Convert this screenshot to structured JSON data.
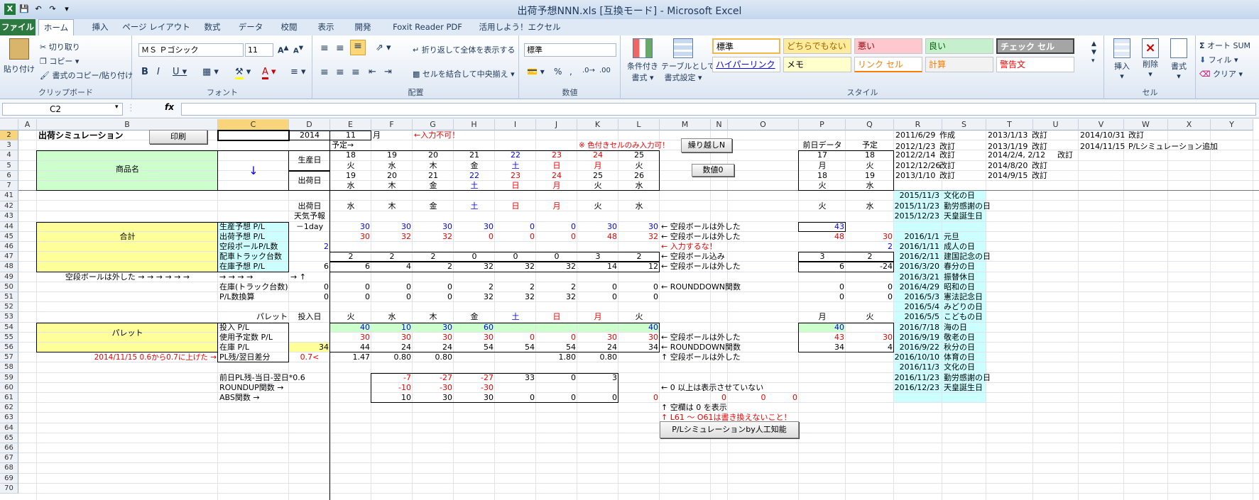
{
  "window": {
    "title": "出荷予想NNN.xls  [互換モード] - Microsoft Excel"
  },
  "ribbon": {
    "tabs": [
      "ファイル",
      "ホーム",
      "挿入",
      "ページ レイアウト",
      "数式",
      "データ",
      "校閲",
      "表示",
      "開発",
      "Foxit Reader PDF",
      "活用しよう！エクセル"
    ],
    "groups": {
      "clipboard": "クリップボード",
      "font": "フォント",
      "align": "配置",
      "number": "数値",
      "styles": "スタイル",
      "cells": "セル"
    },
    "paste": "貼り付け",
    "cut": "切り取り",
    "copy": "コピー ▾",
    "format_painter": "書式のコピー/貼り付け",
    "font_name": "ＭＳ Ｐゴシック",
    "font_size": "11",
    "wrap": "折り返して全体を表示する",
    "merge": "セルを結合して中央揃え ▾",
    "number_format": "標準",
    "cond_format": "条件付き",
    "cond_format2": "書式 ▾",
    "table_format": "テーブルとして",
    "table_format2": "書式設定 ▾",
    "styles": [
      {
        "label": "標準",
        "bg": "#ffffff",
        "fg": "#000000"
      },
      {
        "label": "どちらでもない",
        "bg": "#ffeb9c",
        "fg": "#9c6500"
      },
      {
        "label": "悪い",
        "bg": "#ffc7ce",
        "fg": "#9c0006"
      },
      {
        "label": "良い",
        "bg": "#c6efce",
        "fg": "#006100"
      },
      {
        "label": "チェック セル",
        "bg": "#a5a5a5",
        "fg": "#ffffff"
      },
      {
        "label": "ハイパーリンク",
        "bg": "#ffffff",
        "fg": "#0000ff"
      },
      {
        "label": "メモ",
        "bg": "#ffffcc",
        "fg": "#000000"
      },
      {
        "label": "リンク セル",
        "bg": "#ffffff",
        "fg": "#fa7d00"
      },
      {
        "label": "計算",
        "bg": "#f2f2f2",
        "fg": "#fa7d00"
      },
      {
        "label": "警告文",
        "bg": "#ffffff",
        "fg": "#ff0000"
      }
    ],
    "insert": "挿入",
    "delete": "削除",
    "format": "書式",
    "autosum": "オート SUM",
    "fill": "フィル ▾",
    "clear": "クリア ▾"
  },
  "formula_bar": {
    "name_box": "C2",
    "fx": "fx",
    "value": ""
  },
  "columns": [
    "A",
    "B",
    "C",
    "D",
    "E",
    "F",
    "G",
    "H",
    "I",
    "J",
    "K",
    "L",
    "M",
    "N",
    "O",
    "P",
    "Q",
    "R",
    "S",
    "T",
    "U",
    "V",
    "W",
    "X",
    "Y"
  ],
  "rows": [
    "2",
    "3",
    "4",
    "5",
    "6",
    "7",
    "41",
    "42",
    "43",
    "44",
    "45",
    "46",
    "47",
    "48",
    "49",
    "50",
    "51",
    "52",
    "53",
    "54",
    "55",
    "56",
    "57",
    "58",
    "59",
    "60",
    "61",
    "62",
    "63",
    "64",
    "65",
    "66",
    "67",
    "68",
    "69",
    "70"
  ],
  "sheet": {
    "title": "出荷シミュレーション",
    "print_btn": "印刷",
    "year": "2014",
    "month": "11",
    "month_unit": "月",
    "warn_input": "←入力不可！",
    "yotei_arrow": "予定→",
    "color_only": "※ 色付きセルのみ入力可！",
    "kurikoshi_btn": "繰り越しN",
    "zero_btn": "数値0",
    "product_name": "商品名",
    "down_arrow": "↓",
    "seisan_bi": "生産日",
    "shukka_bi": "出荷日",
    "prod_days": [
      "18",
      "19",
      "20",
      "21",
      "22",
      "23",
      "24",
      "25"
    ],
    "prod_dow": [
      "火",
      "水",
      "木",
      "金",
      "土",
      "日",
      "月",
      "火"
    ],
    "ship_days": [
      "19",
      "20",
      "21",
      "22",
      "23",
      "24",
      "25",
      "26"
    ],
    "ship_dow": [
      "水",
      "木",
      "金",
      "土",
      "日",
      "月",
      "火",
      "水"
    ],
    "prev_data": "前日データ",
    "yotei": "予定",
    "pq_prod_days": [
      "17",
      "18"
    ],
    "pq_prod_dow": [
      "月",
      "火"
    ],
    "pq_ship_days": [
      "18",
      "19"
    ],
    "pq_ship_dow": [
      "火",
      "水"
    ],
    "r41_label": "出荷日",
    "r41_sub": "天気予報",
    "r41_dow": [
      "水",
      "木",
      "金",
      "土",
      "日",
      "月",
      "火",
      "水"
    ],
    "r41_pq": [
      "火",
      "水"
    ],
    "total": "合計",
    "labels44_51": [
      "生産予想 P/L",
      "出荷予想 P/L",
      "空段ボールP/L数",
      "配車トラック台数",
      "在庫予想 P/L",
      "→ → → →",
      "在庫(トラック台数)",
      "P/L数換算"
    ],
    "d44": "－1day",
    "d46": "2",
    "d48": "6",
    "d49": "→ ↑",
    "d50": "0",
    "d51": "0",
    "b49": "空段ボールは外した → → → → → →",
    "r44": [
      "30",
      "30",
      "30",
      "30",
      "0",
      "0",
      "30",
      "30"
    ],
    "r45": [
      "30",
      "32",
      "32",
      "0",
      "0",
      "0",
      "48",
      "32"
    ],
    "r47": [
      "2",
      "2",
      "2",
      "0",
      "0",
      "0",
      "3",
      "2"
    ],
    "r48": [
      "6",
      "4",
      "2",
      "32",
      "32",
      "32",
      "14",
      "12"
    ],
    "r50": [
      "0",
      "0",
      "0",
      "2",
      "2",
      "2",
      "0",
      "0"
    ],
    "r51": [
      "0",
      "0",
      "0",
      "32",
      "32",
      "32",
      "0",
      "0"
    ],
    "m44": "← 空段ボールは外した",
    "m45": "← 空段ボールは外した",
    "m46": "← 入力するな！",
    "m47": "← 空段ボール込み",
    "m48": "← 空段ボールは外した",
    "m50": "← ROUNDDOWN関数",
    "p44": "43",
    "p45": "48",
    "q45": "30",
    "q46": "2",
    "p47": "3",
    "q47": "2",
    "p48": "6",
    "q48": "-24",
    "p50": "0",
    "q50": "0",
    "p51": "0",
    "q51": "0",
    "c53": "パレット",
    "d53": "投入日",
    "r53_dow": [
      "火",
      "水",
      "木",
      "金",
      "土",
      "日",
      "月",
      "火"
    ],
    "r53_pq": [
      "月",
      "火"
    ],
    "pallet": "パレット",
    "labels54_57": [
      "投入 P/L",
      "使用予定数 P/L",
      "在庫 P/L",
      "PL残/翌日差分"
    ],
    "d56": "34",
    "d57": "0.7<",
    "r54": [
      "40",
      "10",
      "30",
      "60",
      "",
      "",
      "",
      "40"
    ],
    "r55": [
      "30",
      "30",
      "30",
      "30",
      "0",
      "0",
      "30",
      "30"
    ],
    "r56": [
      "44",
      "24",
      "24",
      "54",
      "54",
      "54",
      "24",
      "34"
    ],
    "r57": [
      "1.47",
      "0.80",
      "0.80",
      "",
      "",
      "1.80",
      "0.80",
      ""
    ],
    "m55": "← 空段ボールは外した",
    "m56": "← ROUNDDOWN関数",
    "m57": "↑ 空段ボールは外した",
    "p54": "40",
    "p55": "43",
    "q55": "30",
    "p56": "34",
    "q56": "4",
    "b57": "2014/11/15 0.6から0.7に上げた →",
    "labels59_61": [
      "前日PL残-当日-翌日*0.6",
      "ROUNDUP関数 →",
      "ABS関数 →"
    ],
    "r59": [
      "-7",
      "-27",
      "-27",
      "33",
      "0",
      "3"
    ],
    "r60": [
      "-10",
      "-30",
      "-30",
      "",
      "",
      ""
    ],
    "r61": [
      "10",
      "30",
      "30",
      "0",
      "0",
      "0"
    ],
    "l61": "0",
    "n61": "0",
    "o61a": "0",
    "o61b": "0",
    "m60": "← 0 以上は表示させていない",
    "m61": "↑ 空欄は 0 を表示",
    "m62": "↑ L61 ～ O61は書き換えないこと！",
    "ai_btn": "P/Lシミュレーションby人工知能",
    "log": [
      [
        "2011/6/29",
        "作成",
        "2013/1/13",
        "改訂",
        "2014/10/31",
        "改訂"
      ],
      [
        "2012/1/23",
        "改訂",
        "2013/1/19",
        "改訂",
        "2014/11/15",
        "P/Lシミュレーション追加"
      ],
      [
        "2012/2/14",
        "改訂",
        "2014/2/4, 2/12",
        "改訂",
        "",
        ""
      ],
      [
        "2012/12/26",
        "改訂",
        "2014/8/20",
        "改訂",
        "",
        ""
      ],
      [
        "2013/1/10",
        "改訂",
        "2014/9/15",
        "改訂",
        "",
        ""
      ]
    ],
    "holidays": [
      [
        "2015/11/3",
        "文化の日"
      ],
      [
        "2015/11/23",
        "勤労感謝の日"
      ],
      [
        "2015/12/23",
        "天皇誕生日"
      ],
      [
        "",
        ""
      ],
      [
        "2016/1/1",
        "元旦"
      ],
      [
        "2016/1/11",
        "成人の日"
      ],
      [
        "2016/2/11",
        "建国記念の日"
      ],
      [
        "2016/3/20",
        "春分の日"
      ],
      [
        "2016/3/21",
        "振替休日"
      ],
      [
        "2016/4/29",
        "昭和の日"
      ],
      [
        "2016/5/3",
        "憲法記念日"
      ],
      [
        "2016/5/4",
        "みどりの日"
      ],
      [
        "2016/5/5",
        "こどもの日"
      ],
      [
        "2016/7/18",
        "海の日"
      ],
      [
        "2016/9/19",
        "敬老の日"
      ],
      [
        "2016/9/22",
        "秋分の日"
      ],
      [
        "2016/10/10",
        "体育の日"
      ],
      [
        "2016/11/3",
        "文化の日"
      ],
      [
        "2016/11/23",
        "勤労感謝の日"
      ],
      [
        "2016/12/23",
        "天皇誕生日"
      ]
    ],
    "colors": {
      "green": "#ccffcc",
      "yellow": "#ffff99",
      "cyan": "#ccffff",
      "red": "#ff0000",
      "blue": "#0000ff"
    }
  }
}
